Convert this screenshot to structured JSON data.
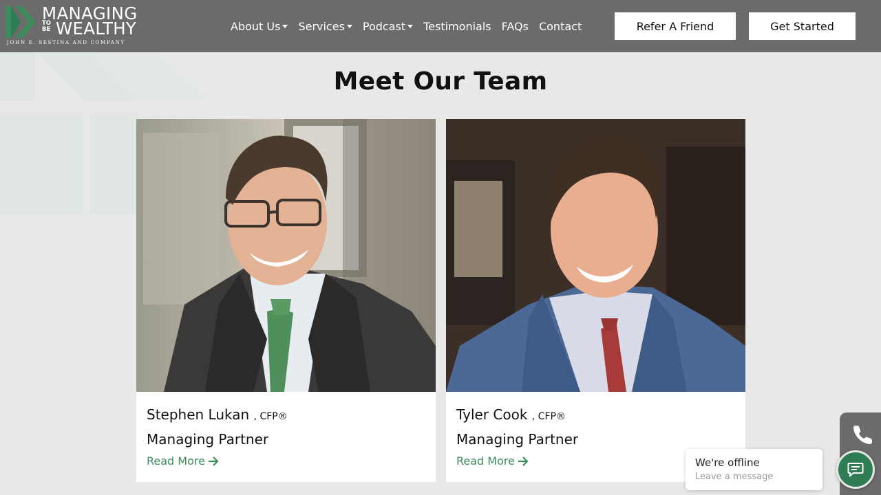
{
  "brand": {
    "logo_top": "MANAGING",
    "logo_tobe": "TO\nBE",
    "logo_bottom": "WEALTHY",
    "logo_sub": "JOHN E. SESTINA AND COMPANY",
    "accent_color": "#2f7d55",
    "link_color": "#3d8c5c",
    "header_color": "#6b6b6b"
  },
  "nav": {
    "items": [
      {
        "label": "About Us",
        "has_dropdown": true
      },
      {
        "label": "Services",
        "has_dropdown": true
      },
      {
        "label": "Podcast",
        "has_dropdown": true
      },
      {
        "label": "Testimonials",
        "has_dropdown": false
      },
      {
        "label": "FAQs",
        "has_dropdown": false
      },
      {
        "label": "Contact",
        "has_dropdown": false
      }
    ],
    "refer_label": "Refer A Friend",
    "start_label": "Get Started"
  },
  "team": {
    "title": "Meet Our Team",
    "members": [
      {
        "name": "Stephen Lukan",
        "credential": ", CFP®",
        "role": "Managing Partner",
        "link": "Read More"
      },
      {
        "name": "Tyler Cook",
        "credential": ", CFP®",
        "role": "Managing Partner",
        "link": "Read More"
      }
    ]
  },
  "chat": {
    "status": "We're offline",
    "prompt": "Leave a message"
  },
  "icons": {
    "phone": "phone-icon",
    "chat": "chat-bubble-icon",
    "arrow": "arrow-right-icon",
    "caret": "caret-down-icon"
  }
}
